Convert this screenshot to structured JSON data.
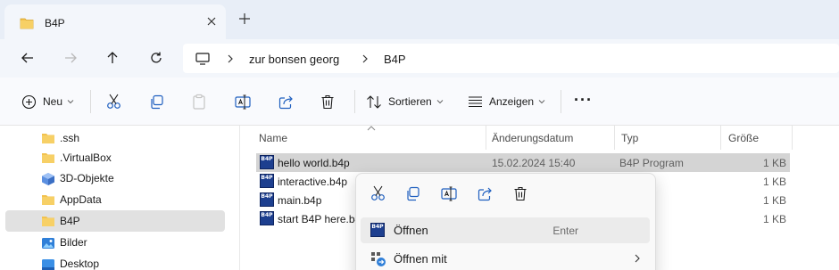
{
  "window": {
    "tab_title": "B4P",
    "new_tab_symbol": "+"
  },
  "address": {
    "crumbs": [
      "zur bonsen georg",
      "B4P"
    ]
  },
  "toolbar": {
    "new_label": "Neu",
    "sort_label": "Sortieren",
    "view_label": "Anzeigen",
    "more_symbol": "···"
  },
  "tree": {
    "items": [
      {
        "label": ".ssh",
        "icon": "folder-icon"
      },
      {
        "label": ".VirtualBox",
        "icon": "folder-icon"
      },
      {
        "label": "3D-Objekte",
        "icon": "3d-objects-icon"
      },
      {
        "label": "AppData",
        "icon": "folder-icon"
      },
      {
        "label": "B4P",
        "icon": "folder-icon",
        "selected": true
      },
      {
        "label": "Bilder",
        "icon": "pictures-icon"
      },
      {
        "label": "Desktop",
        "icon": "desktop-icon"
      }
    ]
  },
  "list": {
    "headers": {
      "name": "Name",
      "date": "Änderungsdatum",
      "type": "Typ",
      "size": "Größe"
    },
    "rows": [
      {
        "name": "hello world.b4p",
        "date": "15.02.2024 15:40",
        "type": "B4P Program",
        "size": "1 KB",
        "selected": true
      },
      {
        "name": "interactive.b4p",
        "date": "",
        "type": "ogram",
        "size": "1 KB"
      },
      {
        "name": "main.b4p",
        "date": "",
        "type": "ogram",
        "size": "1 KB"
      },
      {
        "name": "start B4P here.b4",
        "date": "",
        "type": "ogram",
        "size": "1 KB"
      }
    ]
  },
  "context_menu": {
    "open_label": "Öffnen",
    "open_accel": "Enter",
    "open_with_label": "Öffnen mit"
  },
  "icon_badge_text": "B4P",
  "colors": {
    "folder": "#f2c24f",
    "accent": "#1d3f8f",
    "selection": "#d4d4d4"
  }
}
